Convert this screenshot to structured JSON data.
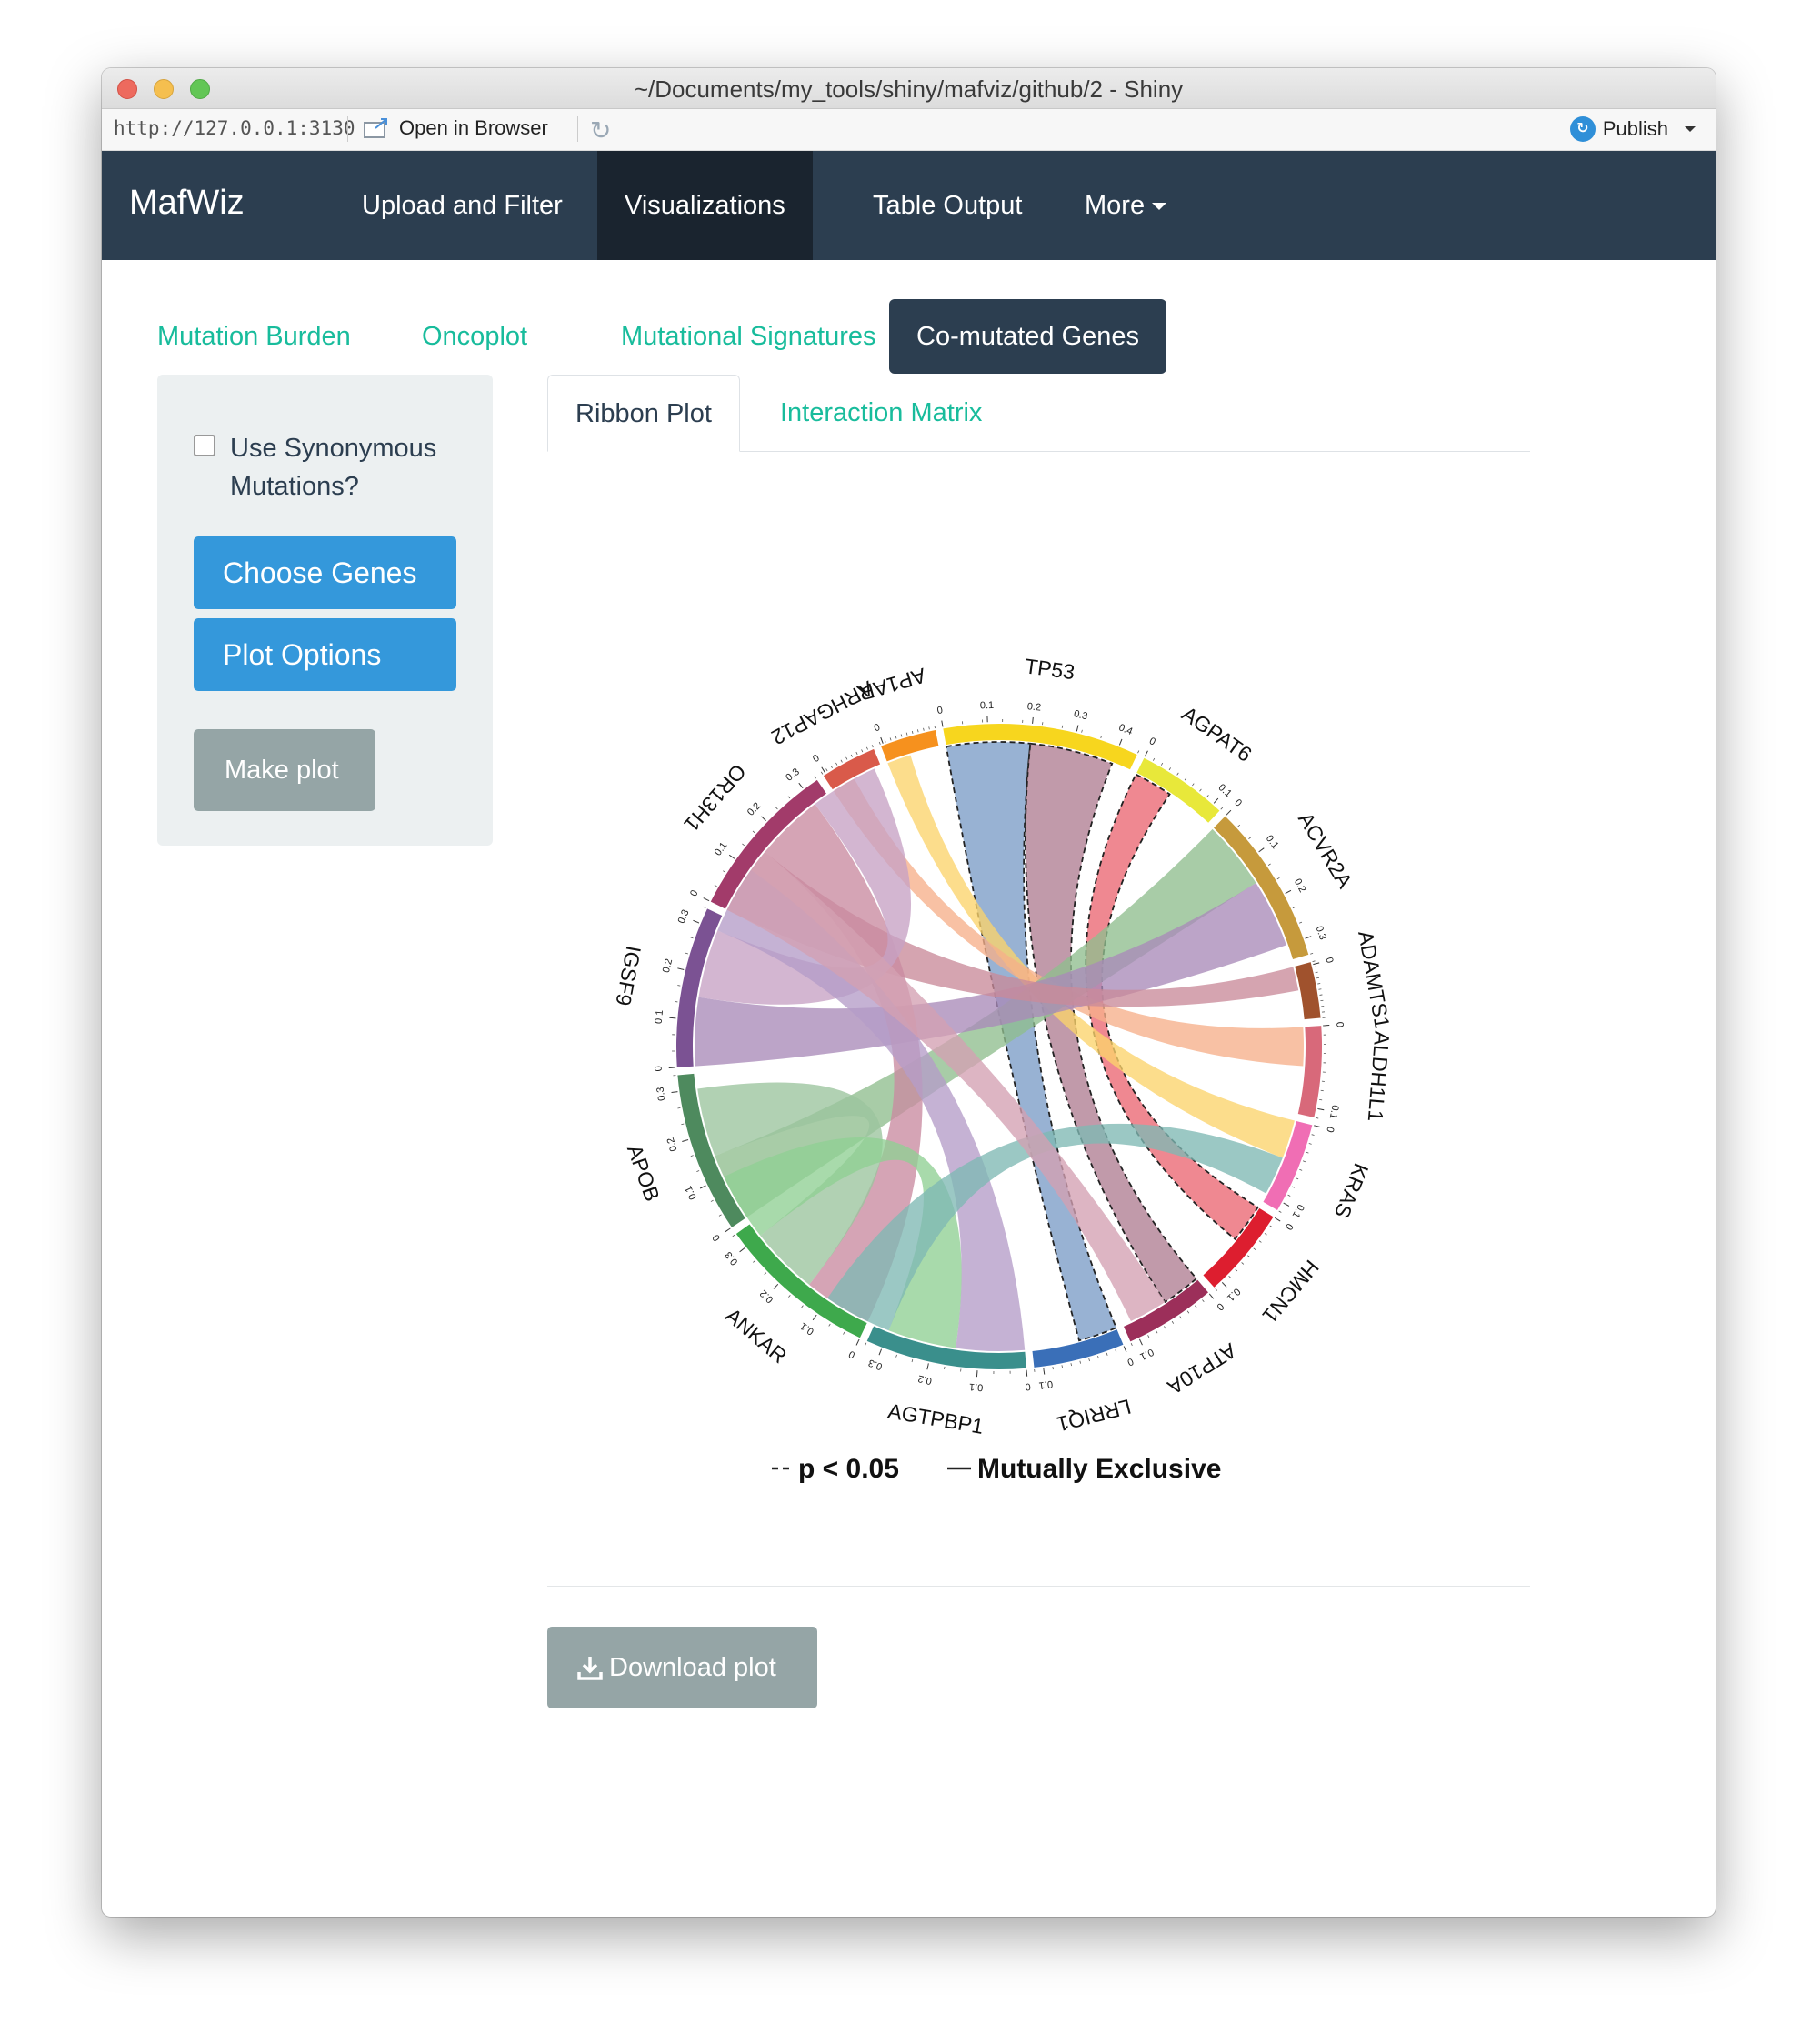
{
  "window": {
    "title": "~/Documents/my_tools/shiny/mafviz/github/2 - Shiny"
  },
  "addressbar": {
    "url": "http://127.0.0.1:3130",
    "open_in_browser": "Open in Browser",
    "publish": "Publish"
  },
  "navbar": {
    "brand": "MafWiz",
    "items": [
      {
        "label": "Upload and Filter",
        "active": false
      },
      {
        "label": "Visualizations",
        "active": true
      },
      {
        "label": "Table Output",
        "active": false
      },
      {
        "label": "More",
        "active": false,
        "dropdown": true
      }
    ]
  },
  "pills": [
    {
      "label": "Mutation Burden",
      "active": false
    },
    {
      "label": "Oncoplot",
      "active": false
    },
    {
      "label": "Mutational Signatures",
      "active": false
    },
    {
      "label": "Co-mutated Genes",
      "active": true
    }
  ],
  "sidebar": {
    "checkbox_label": "Use Synonymous Mutations?",
    "checkbox_checked": false,
    "choose_genes": "Choose Genes",
    "plot_options": "Plot Options",
    "make_plot": "Make plot"
  },
  "subtabs": [
    {
      "label": "Ribbon Plot",
      "active": true
    },
    {
      "label": "Interaction Matrix",
      "active": false
    }
  ],
  "chart_data": {
    "type": "chord",
    "title": "",
    "genes": [
      {
        "name": "TP53",
        "color": "#f7d61e",
        "ticks": [
          "0",
          "0.1",
          "0.2",
          "0.3",
          "0.4"
        ]
      },
      {
        "name": "AGPAT6",
        "color": "#e8e83a",
        "ticks": [
          "0",
          "0.1"
        ]
      },
      {
        "name": "ACVR2A",
        "color": "#c69a3c",
        "ticks": [
          "0",
          "0.1",
          "0.2",
          "0.3"
        ]
      },
      {
        "name": "ADAMTS1",
        "color": "#a0522d",
        "ticks": [
          "0"
        ]
      },
      {
        "name": "ALDH1L1",
        "color": "#d8697a",
        "ticks": [
          "0",
          "0.1"
        ]
      },
      {
        "name": "KRAS",
        "color": "#f06eb4",
        "ticks": [
          "0",
          "0.1"
        ]
      },
      {
        "name": "HMCN1",
        "color": "#dd1e2f",
        "ticks": [
          "0",
          "0.1"
        ]
      },
      {
        "name": "ATP10A",
        "color": "#9c2f5a",
        "ticks": [
          "0",
          "0.1"
        ]
      },
      {
        "name": "LRRIQ1",
        "color": "#3a6fb8",
        "ticks": [
          "0",
          "0.1"
        ]
      },
      {
        "name": "AGTPBP1",
        "color": "#3a8f8c",
        "ticks": [
          "0",
          "0.1",
          "0.2",
          "0.3"
        ]
      },
      {
        "name": "ANKAR",
        "color": "#3ea94c",
        "ticks": [
          "0",
          "0.1",
          "0.2",
          "0.3"
        ]
      },
      {
        "name": "APOB",
        "color": "#4e8a5e",
        "ticks": [
          "0",
          "0.1",
          "0.2",
          "0.3"
        ]
      },
      {
        "name": "IGSF9",
        "color": "#7b5293",
        "ticks": [
          "0",
          "0.1",
          "0.2",
          "0.3"
        ]
      },
      {
        "name": "OR13H1",
        "color": "#a23b6a",
        "ticks": [
          "0",
          "0.1",
          "0.2",
          "0.3"
        ]
      },
      {
        "name": "ARHGAP12",
        "color": "#d95a4a",
        "ticks": [
          "0"
        ]
      },
      {
        "name": "AP1AR",
        "color": "#f6911e",
        "ticks": [
          "0"
        ]
      }
    ],
    "links": [
      {
        "from": "TP53",
        "to": "LRRIQ1",
        "color": "#7b9cc6",
        "significant": true
      },
      {
        "from": "TP53",
        "to": "ATP10A",
        "color": "#b07e92",
        "significant": true
      },
      {
        "from": "AGPAT6",
        "to": "HMCN1",
        "color": "#eb6672",
        "significant": true
      },
      {
        "from": "AP1AR",
        "to": "KRAS",
        "color": "#fbd36b",
        "significant": false
      },
      {
        "from": "ARHGAP12",
        "to": "ALDH1L1",
        "color": "#f6b08a",
        "significant": false
      },
      {
        "from": "ACVR2A",
        "to": "APOB",
        "color": "#8fbe8e",
        "significant": false
      },
      {
        "from": "ACVR2A",
        "to": "IGSF9",
        "color": "#a98bb8",
        "significant": false
      },
      {
        "from": "ADAMTS1",
        "to": "OR13H1",
        "color": "#c98a9a",
        "significant": false
      },
      {
        "from": "OR13H1",
        "to": "ANKAR",
        "color": "#c98aa0",
        "significant": false
      },
      {
        "from": "OR13H1",
        "to": "IGSF9",
        "color": "#c6a2c4",
        "significant": false
      },
      {
        "from": "IGSF9",
        "to": "AGTPBP1",
        "color": "#b59cc8",
        "significant": false
      },
      {
        "from": "ANKAR",
        "to": "APOB",
        "color": "#9bc49d",
        "significant": false
      },
      {
        "from": "ANKAR",
        "to": "AGTPBP1",
        "color": "#8fcf94",
        "significant": false
      },
      {
        "from": "KRAS",
        "to": "AGTPBP1",
        "color": "#7fb9b4",
        "significant": false
      },
      {
        "from": "OR13H1",
        "to": "ATP10A",
        "color": "#d3a0b2",
        "significant": false
      }
    ],
    "legend": {
      "dashed_label": "p < 0.05",
      "solid_label": "Mutually Exclusive"
    }
  },
  "download_button": "Download plot"
}
